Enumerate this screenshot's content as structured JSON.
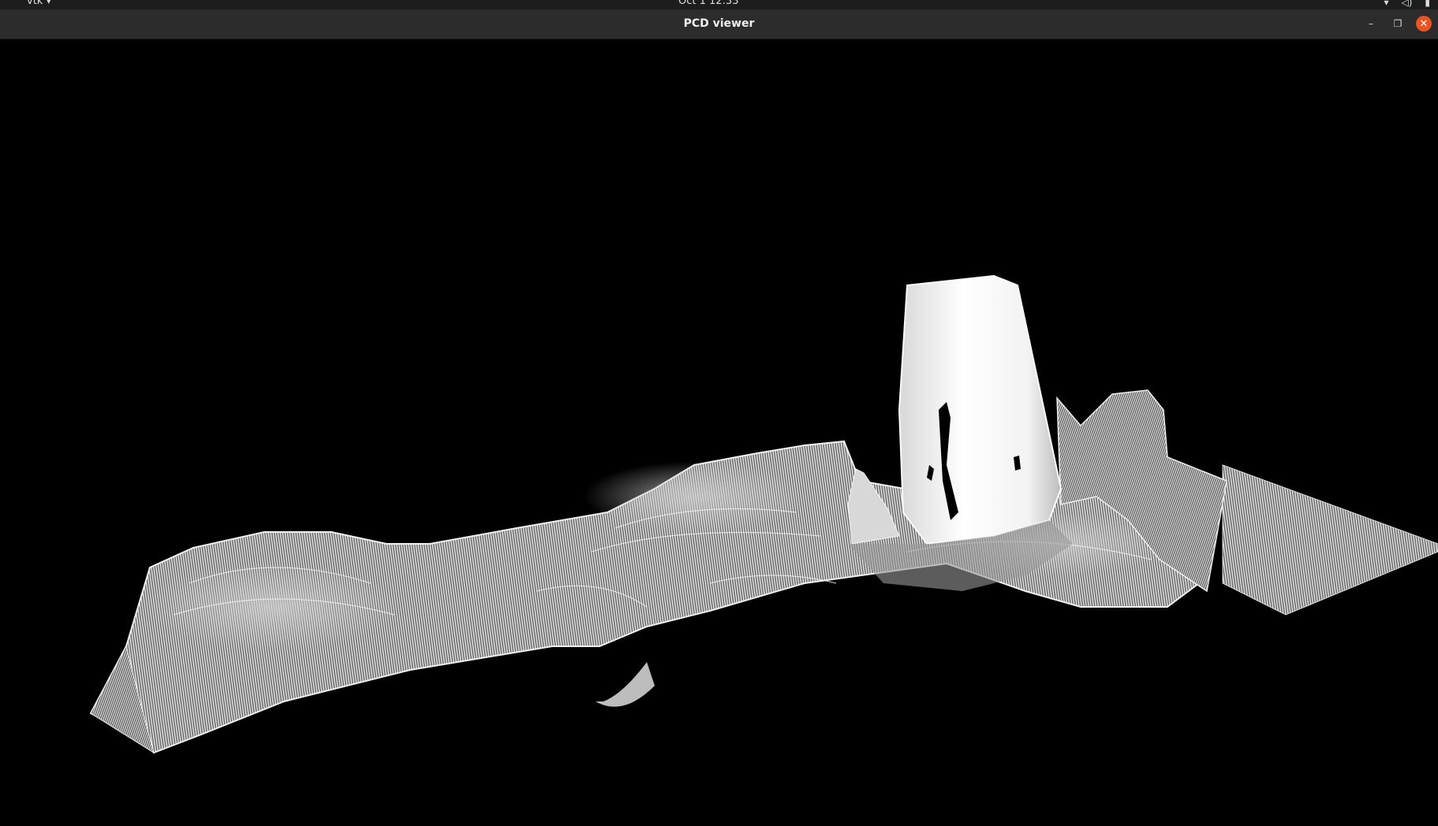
{
  "topbar": {
    "app_menu": "vtk ▾",
    "clock": "Oct 1  12:33",
    "tray_network_icon": "network-icon",
    "tray_sound_icon": "sound-icon",
    "tray_battery_icon": "battery-icon"
  },
  "window": {
    "title": "PCD viewer",
    "minimize_label": "–",
    "maximize_label": "❐",
    "close_label": "✕"
  },
  "viewport": {
    "background": "#000000",
    "point_color": "#ffffff",
    "content": "point-cloud-scene"
  }
}
